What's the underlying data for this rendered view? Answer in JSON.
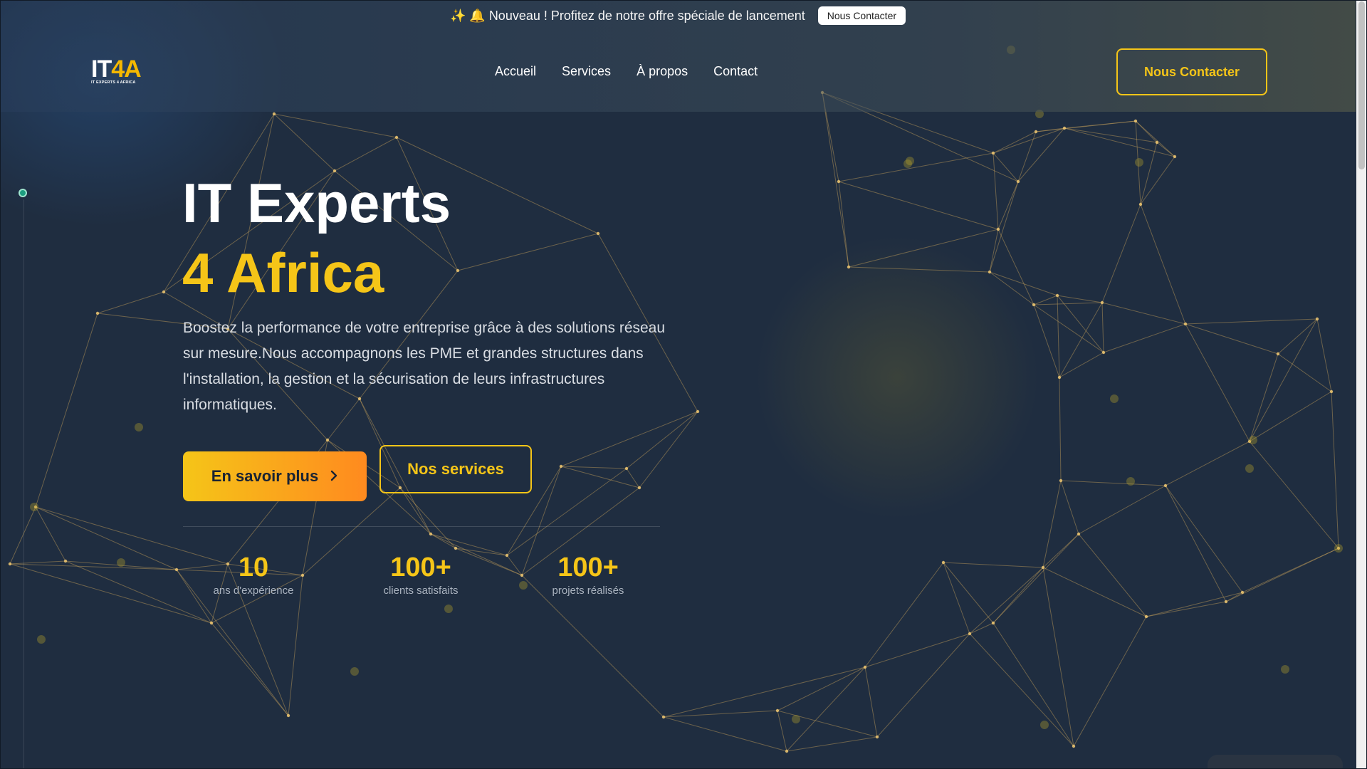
{
  "announcement": {
    "icons": "✨ 🔔",
    "text": "Nouveau ! Profitez de notre offre spéciale de lancement",
    "button_label": "Nous Contacter"
  },
  "logo": {
    "main_prefix": "IT",
    "main_accent": "4A",
    "subtitle": "IT EXPERTS 4 AFRICA"
  },
  "nav": {
    "items": [
      "Accueil",
      "Services",
      "À propos",
      "Contact"
    ]
  },
  "header_cta": "Nous Contacter",
  "hero": {
    "title_line1": "IT Experts",
    "title_line2": "4 Africa",
    "description": "Boostez la performance de votre entreprise grâce à des solutions réseau sur mesure.Nous accompagnons les PME et grandes structures dans l'installation, la gestion et la sécurisation de leurs infrastructures informatiques.",
    "primary_button": "En savoir plus",
    "primary_button_icon": "chevron-right-icon",
    "secondary_button": "Nos services"
  },
  "stats": [
    {
      "value": "10",
      "label": "ans d'expérience"
    },
    {
      "value": "100+",
      "label": "clients satisfaits"
    },
    {
      "value": "100+",
      "label": "projets réalisés"
    }
  ],
  "colors": {
    "background": "#1f2d40",
    "accent": "#f5c518",
    "accent_gradient_end": "#ff8a1f",
    "network_lines": "#c9a35a"
  }
}
